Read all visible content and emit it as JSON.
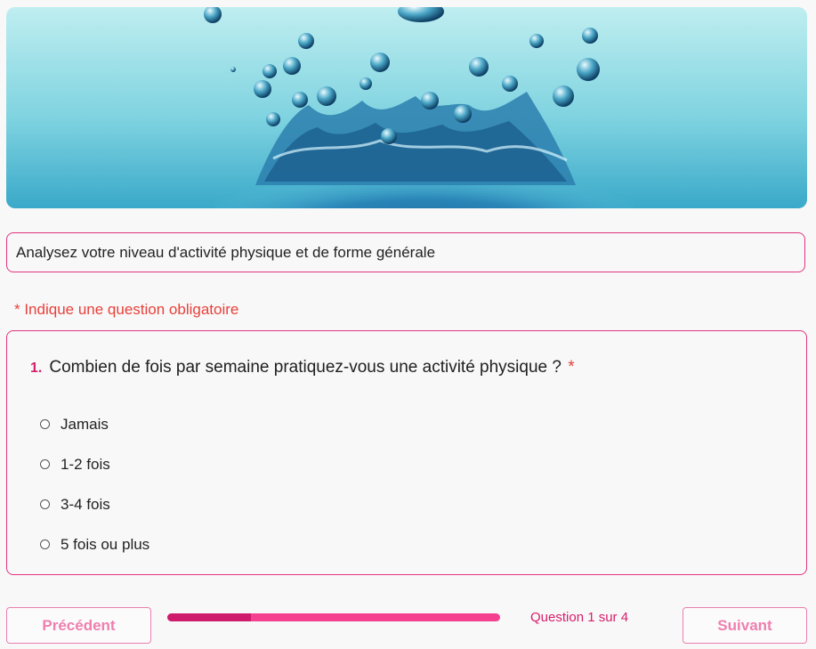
{
  "banner": {
    "image": "water-splash-image"
  },
  "form": {
    "title": "Analysez votre niveau d'activité physique et de forme générale",
    "required_note": "* Indique une question obligatoire"
  },
  "question": {
    "number": "1.",
    "text": "Combien de fois par semaine pratiquez-vous une activité physique ?",
    "required_marker": "*",
    "options": [
      {
        "label": "Jamais",
        "selected": false
      },
      {
        "label": "1-2 fois",
        "selected": false
      },
      {
        "label": "3-4 fois",
        "selected": false
      },
      {
        "label": "5 fois ou plus",
        "selected": false
      }
    ]
  },
  "navigation": {
    "prev_label": "Précédent",
    "next_label": "Suivant",
    "progress_text": "Question 1 sur 4",
    "progress_fraction": 0.25
  },
  "colors": {
    "accent": "#e0337e",
    "progress_fill": "#cf1b6b",
    "progress_track": "#f4408f",
    "required": "#e8413a",
    "button_text": "#ef7fae"
  }
}
